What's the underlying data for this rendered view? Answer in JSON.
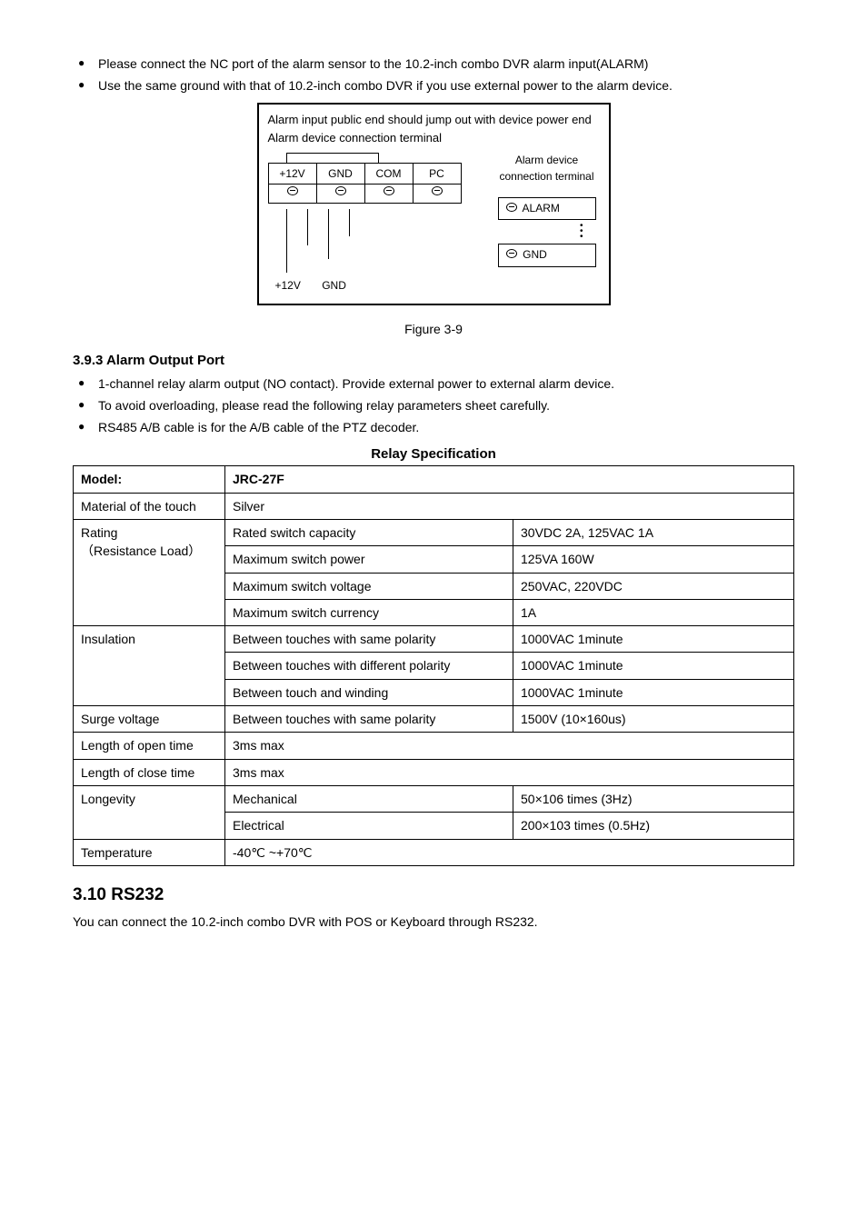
{
  "bullets_top": {
    "b1": "Please connect the NC port of the alarm sensor to the 10.2-inch combo DVR alarm input(ALARM)",
    "b2": "Use the same ground with that of 10.2-inch combo DVR if you use external power to the alarm device."
  },
  "diagram": {
    "top_text": "Alarm input public end should jump out with device power end",
    "sub_text": "Alarm device connection terminal",
    "cols": {
      "c1": "+12V",
      "c2": "GND",
      "c3": "COM",
      "c4": "PC"
    },
    "right_label1": "Alarm device",
    "right_label2": "connection terminal",
    "relay_alarm": "ALARM",
    "relay_gnd": "GND",
    "bottom_12v": "+12V",
    "bottom_gnd": "GND"
  },
  "figure_caption": "Figure 3-9",
  "section_393_title": "3.9.3  Alarm Output Port",
  "bullets_mid": {
    "b1": "1-channel relay alarm output (NO contact). Provide external power to external alarm device.",
    "b2": "To avoid overloading, please read the following relay parameters sheet carefully.",
    "b3": "RS485 A/B cable is for the A/B cable of the PTZ decoder."
  },
  "relay_spec_title": "Relay Specification",
  "table": {
    "model_label": "Model:",
    "model_value": "JRC-27F",
    "material_label": "Material of the touch",
    "material_value": "Silver",
    "rating_label": "Rating\n（Resistance Load）",
    "rating": {
      "r1a": "Rated switch capacity",
      "r1b": "30VDC 2A, 125VAC 1A",
      "r2a": "Maximum switch power",
      "r2b": "125VA 160W",
      "r3a": "Maximum switch voltage",
      "r3b": "250VAC, 220VDC",
      "r4a": "Maximum switch currency",
      "r4b": "1A"
    },
    "insulation_label": "Insulation",
    "insulation": {
      "i1a": "Between touches with same polarity",
      "i1b": "1000VAC 1minute",
      "i2a": "Between touches with different polarity",
      "i2b": "1000VAC 1minute",
      "i3a": "Between touch and winding",
      "i3b": "1000VAC 1minute"
    },
    "surge_label": "Surge voltage",
    "surge_a": "Between touches with same polarity",
    "surge_b": "1500V (10×160us)",
    "open_label": "Length of open time",
    "open_value": "3ms max",
    "close_label": "Length of close time",
    "close_value": "3ms max",
    "longevity_label": "Longevity",
    "longevity": {
      "l1a": "Mechanical",
      "l1b": "50×106 times (3Hz)",
      "l2a": "Electrical",
      "l2b": "200×103 times (0.5Hz)"
    },
    "temp_label": "Temperature",
    "temp_value": "-40℃ ~+70℃"
  },
  "rs232_heading": "3.10 RS232",
  "rs232_text": "You can connect the 10.2-inch combo DVR with POS or Keyboard through RS232."
}
